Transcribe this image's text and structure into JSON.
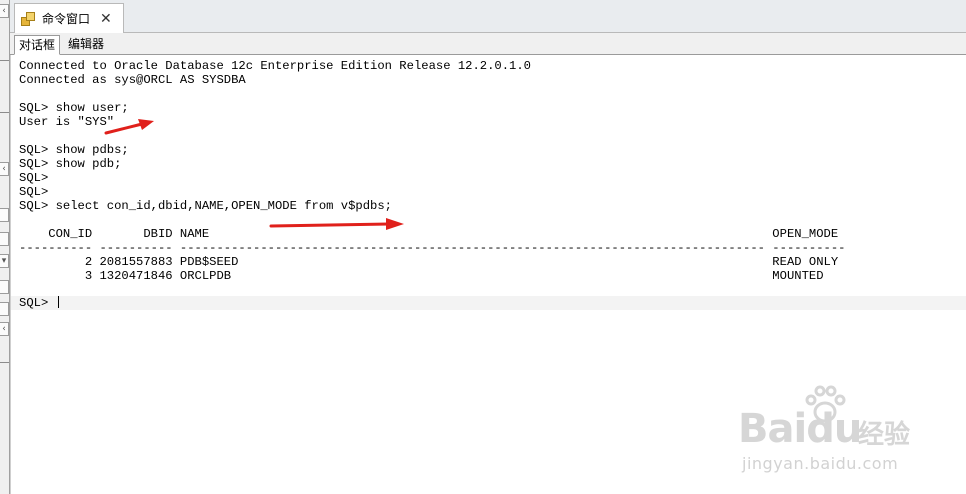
{
  "window": {
    "tab_title": "命令窗口",
    "close_symbol": "✕"
  },
  "subtabs": [
    {
      "label": "对话框",
      "active": true
    },
    {
      "label": "编辑器",
      "active": false
    }
  ],
  "console": {
    "lines": [
      "Connected to Oracle Database 12c Enterprise Edition Release 12.2.0.1.0",
      "Connected as sys@ORCL AS SYSDBA",
      "",
      "SQL> show user;",
      "User is \"SYS\"",
      "",
      "SQL> show pdbs;",
      "SQL> show pdb;",
      "SQL>",
      "SQL>",
      "SQL> select con_id,dbid,NAME,OPEN_MODE from v$pdbs;",
      "",
      "    CON_ID       DBID NAME                                                                             OPEN_MODE",
      "---------- ---------- -------------------------------------------------------------------------------- ----------",
      "         2 2081557883 PDB$SEED                                                                         READ ONLY",
      "         3 1320471846 ORCLPDB                                                                          MOUNTED"
    ],
    "prompt": "SQL> "
  },
  "icons": {
    "left_toolbar": [
      "chevron-left-icon",
      "chevron-left-icon",
      "chevron-left-icon"
    ],
    "annotation": "red-arrow-icon"
  },
  "colors": {
    "arrow": "#e0201b",
    "tab_bar": "#e9ecef",
    "watermark": "#d6d6d6"
  },
  "watermark": {
    "brand": "Baidu",
    "brand_cn": "经验",
    "url": "jingyan.baidu.com"
  }
}
